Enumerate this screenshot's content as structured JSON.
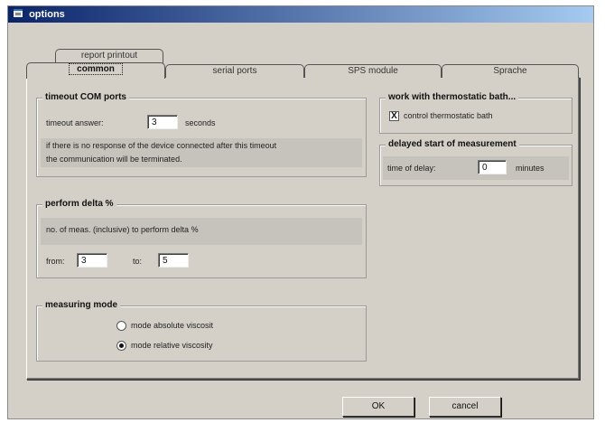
{
  "window": {
    "title": "options"
  },
  "tabs": {
    "back": [
      {
        "label": "report printout"
      }
    ],
    "front": [
      {
        "label": "common",
        "active": true
      },
      {
        "label": "serial ports",
        "active": false
      },
      {
        "label": "SPS module",
        "active": false
      },
      {
        "label": "Sprache",
        "active": false
      }
    ]
  },
  "timeout": {
    "title": "timeout COM ports",
    "answer_label": "timeout answer:",
    "answer_value": "3",
    "unit": "seconds",
    "note_line1": "if there is no response of the device connected after this timeout",
    "note_line2": "the communication will be terminated."
  },
  "delta": {
    "title": "perform delta %",
    "description": "no. of meas. (inclusive) to perform delta %",
    "from_label": "from:",
    "from_value": "3",
    "to_label": "to:",
    "to_value": "5"
  },
  "mode": {
    "title": "measuring mode",
    "options": [
      {
        "label": "mode absolute viscosit",
        "selected": false
      },
      {
        "label": "mode relative viscosity",
        "selected": true
      }
    ]
  },
  "bath": {
    "title": "work with thermostatic bath...",
    "checkbox_label": "control thermostatic bath",
    "checked": true,
    "check_mark": "X"
  },
  "delay": {
    "title": "delayed start of measurement",
    "label": "time of delay:",
    "value": "0",
    "unit": "minutes"
  },
  "buttons": {
    "ok": "OK",
    "cancel": "cancel"
  },
  "colors": {
    "titlebar_start": "#0a246a",
    "titlebar_end": "#a6caf0",
    "face": "#d4d0c8"
  }
}
